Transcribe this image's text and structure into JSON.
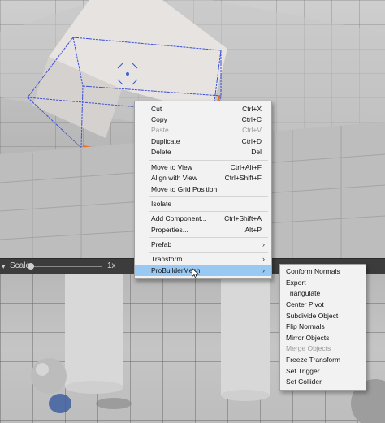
{
  "scale_bar": {
    "label": "Scale",
    "value": "1x",
    "level": 0
  },
  "context_menu": {
    "items": [
      {
        "label": "Cut",
        "shortcut": "Ctrl+X",
        "enabled": true
      },
      {
        "label": "Copy",
        "shortcut": "Ctrl+C",
        "enabled": true
      },
      {
        "label": "Paste",
        "shortcut": "Ctrl+V",
        "enabled": false
      },
      {
        "label": "Duplicate",
        "shortcut": "Ctrl+D",
        "enabled": true
      },
      {
        "label": "Delete",
        "shortcut": "Del",
        "enabled": true
      },
      {
        "label": "Move to View",
        "shortcut": "Ctrl+Alt+F",
        "enabled": true
      },
      {
        "label": "Align with View",
        "shortcut": "Ctrl+Shift+F",
        "enabled": true
      },
      {
        "label": "Move to Grid Position",
        "shortcut": "",
        "enabled": true
      },
      {
        "label": "Isolate",
        "shortcut": "",
        "enabled": true
      },
      {
        "label": "Add Component...",
        "shortcut": "Ctrl+Shift+A",
        "enabled": true
      },
      {
        "label": "Properties...",
        "shortcut": "Alt+P",
        "enabled": true
      },
      {
        "label": "Prefab",
        "shortcut": "",
        "submenu": true,
        "enabled": true
      },
      {
        "label": "Transform",
        "shortcut": "",
        "submenu": true,
        "enabled": true
      },
      {
        "label": "ProBuilderMesh",
        "shortcut": "",
        "submenu": true,
        "enabled": true,
        "highlighted": true
      }
    ]
  },
  "submenu": {
    "items": [
      {
        "label": "Conform Normals",
        "enabled": true
      },
      {
        "label": "Export",
        "enabled": true
      },
      {
        "label": "Triangulate",
        "enabled": true
      },
      {
        "label": "Center Pivot",
        "enabled": true
      },
      {
        "label": "Subdivide Object",
        "enabled": true
      },
      {
        "label": "Flip Normals",
        "enabled": true
      },
      {
        "label": "Mirror Objects",
        "enabled": true
      },
      {
        "label": "Merge Objects",
        "enabled": false
      },
      {
        "label": "Freeze Transform",
        "enabled": true
      },
      {
        "label": "Set Trigger",
        "enabled": true
      },
      {
        "label": "Set Collider",
        "enabled": true
      }
    ]
  },
  "icons": {
    "submenu_arrow": "chevron-right-icon",
    "cursor": "mouse-pointer-icon",
    "scale_dropdown": "dropdown-icon",
    "viewport_menu": "menu-icon"
  },
  "colors": {
    "highlight": "#99c9f3",
    "selection_orange": "#f06a1c",
    "bounds_blue": "#3b4fd8"
  }
}
